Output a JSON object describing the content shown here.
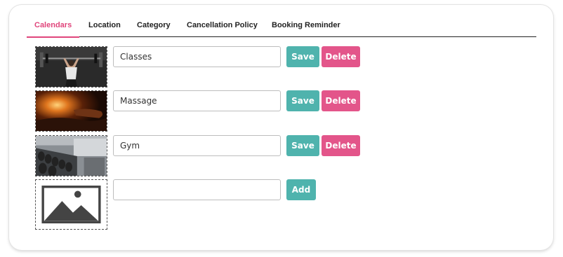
{
  "tabs": [
    {
      "label": "Calendars",
      "active": true
    },
    {
      "label": "Location",
      "active": false
    },
    {
      "label": "Category",
      "active": false
    },
    {
      "label": "Cancellation Policy",
      "active": false
    },
    {
      "label": "Booking Reminder",
      "active": false
    }
  ],
  "calendars": [
    {
      "name": "Classes",
      "image": "weightlifting-photo",
      "save_label": "Save",
      "delete_label": "Delete"
    },
    {
      "name": "Massage",
      "image": "massage-candle-photo",
      "save_label": "Save",
      "delete_label": "Delete"
    },
    {
      "name": "Gym",
      "image": "gym-dumbbells-photo",
      "save_label": "Save",
      "delete_label": "Delete"
    }
  ],
  "new_calendar": {
    "name": "",
    "image": "image-placeholder-icon",
    "add_label": "Add"
  },
  "colors": {
    "accent_pink": "#e0457b",
    "save_teal": "#4fb3ad",
    "delete_pink": "#e3558a"
  }
}
